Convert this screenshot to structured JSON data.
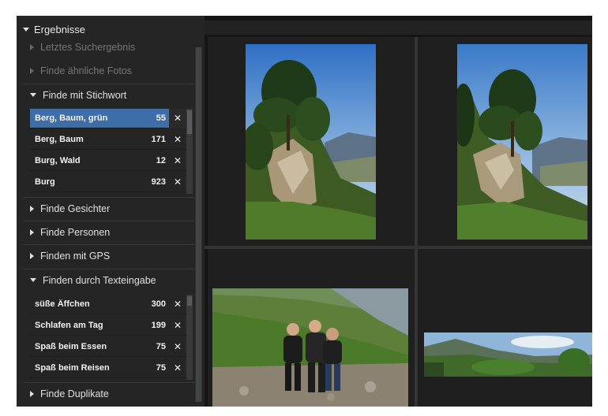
{
  "sidebar": {
    "title": "Ergebnisse",
    "dim_items": [
      {
        "label": "Letztes Suchergebnis"
      },
      {
        "label": "Finde ähnliche Fotos"
      }
    ],
    "keyword_section": {
      "label": "Finde mit Stichwort",
      "rows": [
        {
          "label": "Berg, Baum, grün",
          "count": "55",
          "selected": true
        },
        {
          "label": "Berg, Baum",
          "count": "171"
        },
        {
          "label": "Burg, Wald",
          "count": "12"
        },
        {
          "label": "Burg",
          "count": "923"
        }
      ]
    },
    "collapsed_sections": [
      {
        "label": "Finde Gesichter"
      },
      {
        "label": "Finde Personen"
      },
      {
        "label": "Finden mit GPS"
      }
    ],
    "text_section": {
      "label": "Finden durch Texteingabe",
      "rows": [
        {
          "label": "süße Äffchen",
          "count": "300"
        },
        {
          "label": "Schlafen am Tag",
          "count": "199"
        },
        {
          "label": "Spaß beim Essen",
          "count": "75"
        },
        {
          "label": "Spaß beim Reisen",
          "count": "75"
        }
      ]
    },
    "bottom_section": {
      "label": "Finde Duplikate"
    },
    "remove_glyph": "✕"
  },
  "colors": {
    "accent": "#3d6ea8",
    "panel": "#252525",
    "grid_bg": "#151515"
  }
}
